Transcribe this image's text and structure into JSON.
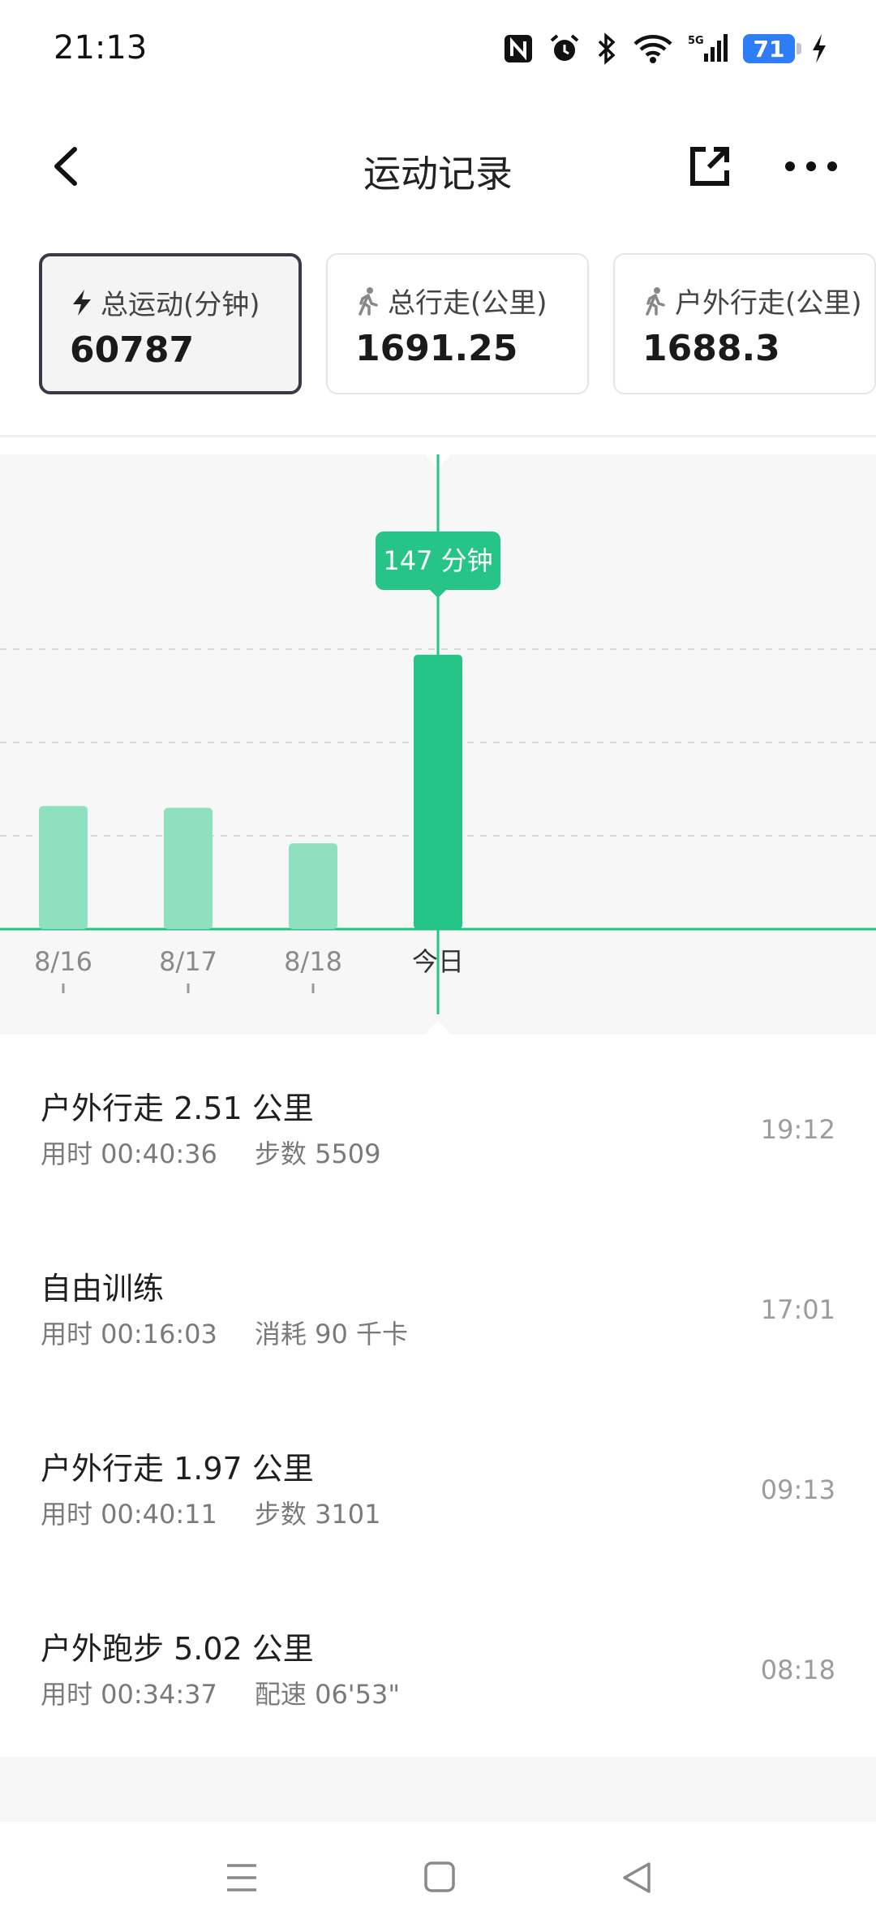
{
  "status_bar": {
    "time": "21:13",
    "battery": "71",
    "network": "5G"
  },
  "header": {
    "title": "运动记录"
  },
  "summary_cards": [
    {
      "label": "总运动(分钟)",
      "value": "60787",
      "icon": "lightning-icon",
      "selected": true
    },
    {
      "label": "总行走(公里)",
      "value": "1691.25",
      "icon": "walk-icon",
      "selected": false
    },
    {
      "label": "户外行走(公里)",
      "value": "1688.3",
      "icon": "walk-icon",
      "selected": false
    }
  ],
  "chart": {
    "tooltip": "147 分钟",
    "colors": {
      "bar": "#8fe0be",
      "bar_selected": "#26c486",
      "axis": "#26c486",
      "grid": "#d9d9d9"
    }
  },
  "chart_data": {
    "type": "bar",
    "categories": [
      "8/16",
      "8/17",
      "8/18",
      "今日"
    ],
    "values": [
      66,
      65,
      46,
      147
    ],
    "selected_index": 3,
    "unit": "分钟",
    "grid": true,
    "gridlines": [
      50,
      100,
      150
    ]
  },
  "records": [
    {
      "title": "户外行走 2.51 公里",
      "detail1": "用时 00:40:36",
      "detail2": "步数 5509",
      "time": "19:12"
    },
    {
      "title": "自由训练",
      "detail1": "用时 00:16:03",
      "detail2": "消耗 90 千卡",
      "time": "17:01"
    },
    {
      "title": "户外行走 1.97 公里",
      "detail1": "用时 00:40:11",
      "detail2": "步数 3101",
      "time": "09:13"
    },
    {
      "title": "户外跑步 5.02 公里",
      "detail1": "用时 00:34:37",
      "detail2": "配速 06'53\"",
      "time": "08:18"
    }
  ]
}
